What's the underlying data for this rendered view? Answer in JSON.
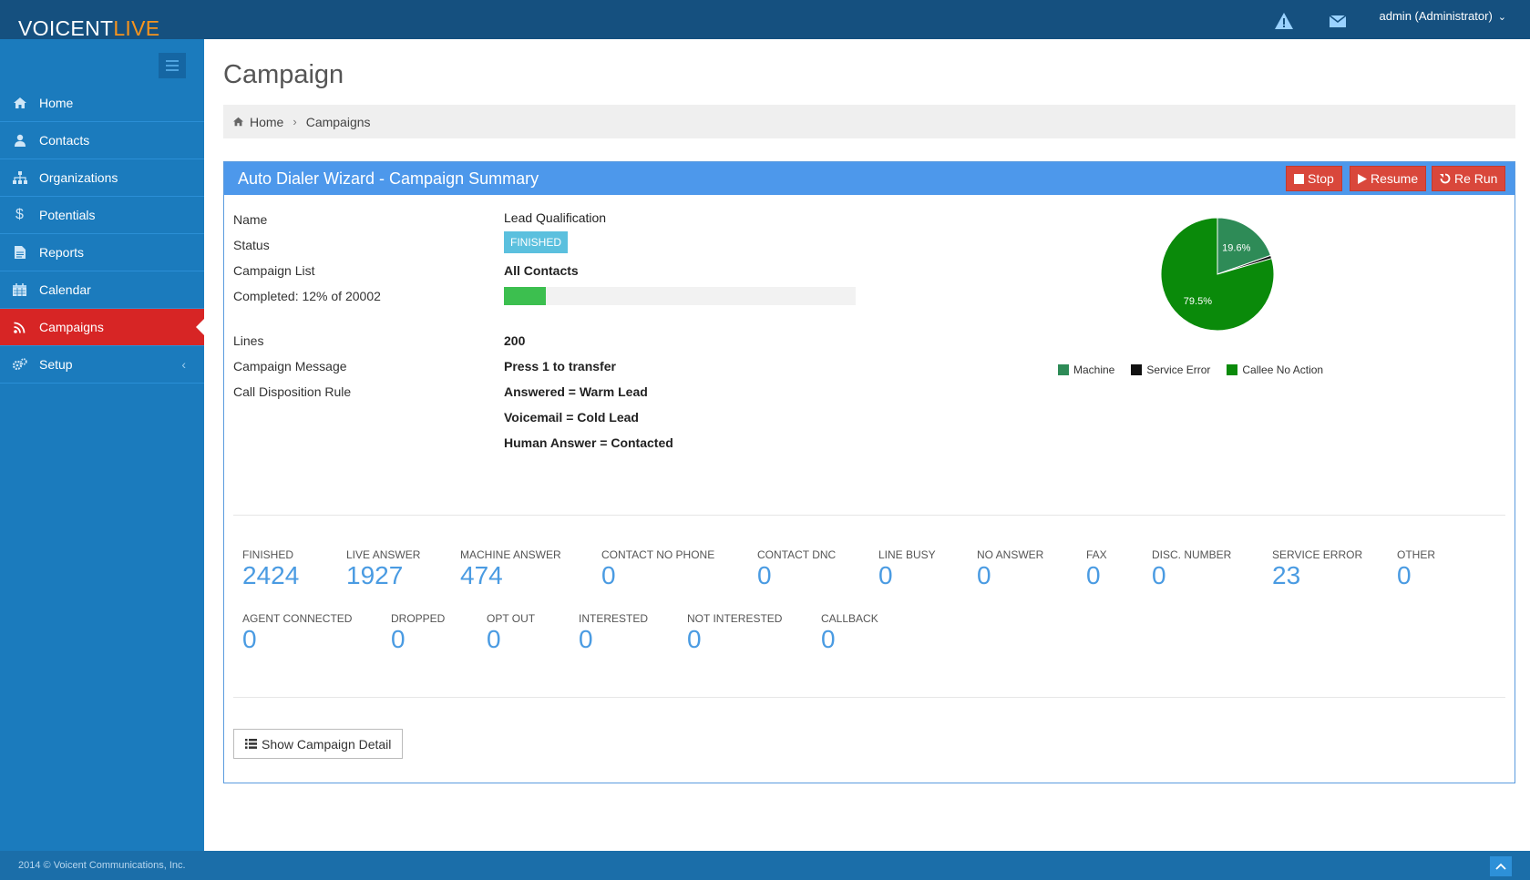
{
  "app": {
    "brand_part1": "VOICENT",
    "brand_part2": "LIVE",
    "user": "admin (Administrator)"
  },
  "sidebar": {
    "items": [
      {
        "label": "Home",
        "icon": "home-icon"
      },
      {
        "label": "Contacts",
        "icon": "user-icon"
      },
      {
        "label": "Organizations",
        "icon": "sitemap-icon"
      },
      {
        "label": "Potentials",
        "icon": "dollar-icon"
      },
      {
        "label": "Reports",
        "icon": "file-icon"
      },
      {
        "label": "Calendar",
        "icon": "calendar-icon"
      },
      {
        "label": "Campaigns",
        "icon": "rss-icon",
        "active": true
      },
      {
        "label": "Setup",
        "icon": "gears-icon"
      }
    ]
  },
  "page": {
    "title": "Campaign",
    "breadcrumb": [
      "Home",
      "Campaigns"
    ]
  },
  "panel": {
    "title": "Auto Dialer Wizard - Campaign Summary",
    "buttons": {
      "stop": "Stop",
      "resume": "Resume",
      "rerun": "Re Run"
    },
    "labels": {
      "name": "Name",
      "status": "Status",
      "campaign_list": "Campaign List",
      "completed": "Completed: 12% of 20002",
      "lines": "Lines",
      "campaign_message": "Campaign Message",
      "call_disposition_rule": "Call Disposition Rule"
    },
    "values": {
      "name": "Lead Qualification",
      "status": "FINISHED",
      "campaign_list": "All Contacts",
      "progress_percent": 12,
      "lines": "200",
      "campaign_message": "Press 1 to transfer",
      "rules": [
        "Answered = Warm Lead",
        "Voicemail = Cold Lead",
        "Human Answer = Contacted"
      ]
    },
    "detail_button": "Show Campaign Detail"
  },
  "stats_row1": [
    {
      "label": "FINISHED",
      "value": "2424"
    },
    {
      "label": "LIVE ANSWER",
      "value": "1927"
    },
    {
      "label": "MACHINE ANSWER",
      "value": "474"
    },
    {
      "label": "CONTACT NO PHONE",
      "value": "0"
    },
    {
      "label": "CONTACT DNC",
      "value": "0"
    },
    {
      "label": "LINE BUSY",
      "value": "0"
    },
    {
      "label": "NO ANSWER",
      "value": "0"
    },
    {
      "label": "FAX",
      "value": "0"
    },
    {
      "label": "DISC. NUMBER",
      "value": "0"
    },
    {
      "label": "SERVICE ERROR",
      "value": "23"
    },
    {
      "label": "OTHER",
      "value": "0"
    }
  ],
  "stats_row2": [
    {
      "label": "AGENT CONNECTED",
      "value": "0"
    },
    {
      "label": "DROPPED",
      "value": "0"
    },
    {
      "label": "OPT OUT",
      "value": "0"
    },
    {
      "label": "INTERESTED",
      "value": "0"
    },
    {
      "label": "NOT INTERESTED",
      "value": "0"
    },
    {
      "label": "CALLBACK",
      "value": "0"
    }
  ],
  "chart_data": {
    "type": "pie",
    "series": [
      {
        "name": "Machine",
        "value": 19.6,
        "color": "#2e8b57",
        "label": "19.6%"
      },
      {
        "name": "Service Error",
        "value": 0.9,
        "color": "#111111",
        "label": ""
      },
      {
        "name": "Callee No Action",
        "value": 79.5,
        "color": "#0a8a0a",
        "label": "79.5%"
      }
    ],
    "legend_position": "bottom"
  },
  "footer": {
    "copyright": "2014 © Voicent Communications, Inc."
  },
  "colors": {
    "topbar": "#15507f",
    "sidebar": "#1b7bbd",
    "active": "#d72525",
    "panel_head": "#4d98eb",
    "stat_value": "#4a9be2"
  }
}
